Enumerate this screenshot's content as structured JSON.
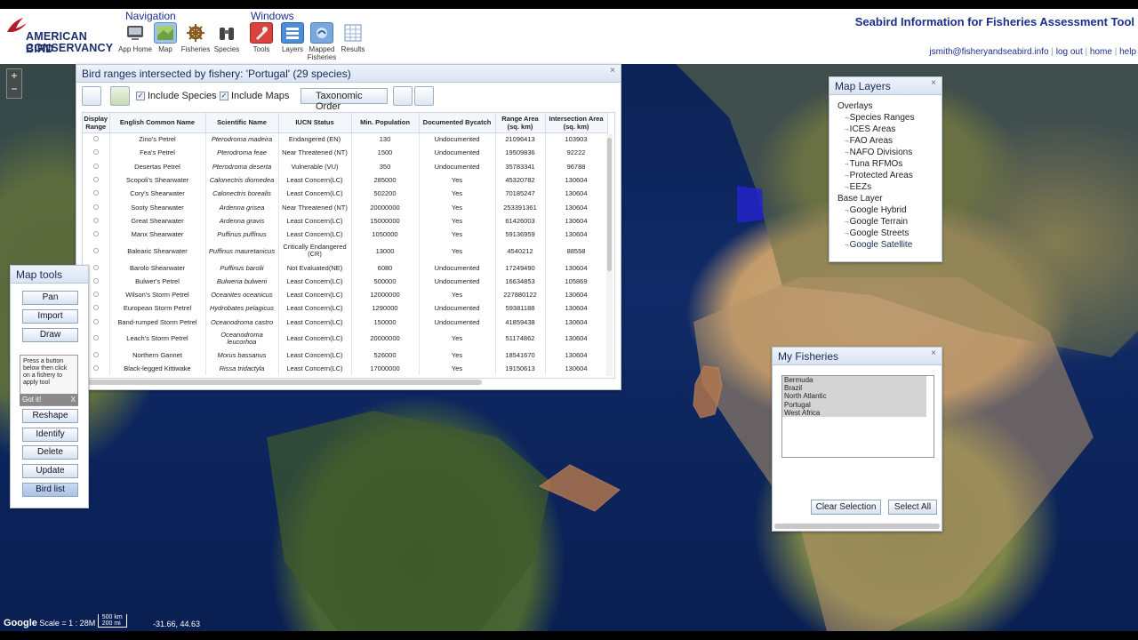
{
  "header": {
    "logo_line1": "AMERICAN BIRD",
    "logo_line2": "CONSERVANCY",
    "nav_heading": "Navigation",
    "windows_heading": "Windows",
    "nav": [
      {
        "label": "App Home",
        "icon": "app-home-icon"
      },
      {
        "label": "Map",
        "icon": "map-icon"
      },
      {
        "label": "Fisheries",
        "icon": "ship-wheel-icon"
      },
      {
        "label": "Species",
        "icon": "binoculars-icon"
      }
    ],
    "windows": [
      {
        "label": "Tools",
        "icon": "tools-icon"
      },
      {
        "label": "Layers",
        "icon": "layers-icon"
      },
      {
        "label": "Mapped Fisheries",
        "icon": "mapped-fisheries-icon"
      },
      {
        "label": "Results",
        "icon": "results-icon"
      }
    ],
    "app_title": "Seabird Information for Fisheries Assessment Tool",
    "user_email": "jsmith@fisheryandseabird.info",
    "links": [
      "log out",
      "home",
      "help"
    ]
  },
  "birds_panel": {
    "title": "Bird ranges intersected by fishery: 'Portugal' (29 species)",
    "include_species": "Include Species",
    "include_maps": "Include Maps",
    "taxonomic_order": "Taxonomic Order",
    "columns": [
      "Display Range",
      "English Common Name",
      "Scientific Name",
      "IUCN Status",
      "Min. Population",
      "Documented Bycatch",
      "Range Area (sq. km)",
      "Intersection Area (sq. km)"
    ],
    "rows": [
      [
        "Zino's Petrel",
        "Pterodroma madeira",
        "Endangered (EN)",
        "130",
        "Undocumented",
        "21096413",
        "103903"
      ],
      [
        "Fea's Petrel",
        "Pterodroma feae",
        "Near Threatened (NT)",
        "1500",
        "Undocumented",
        "19509836",
        "92222"
      ],
      [
        "Desertas Petrel",
        "Pterodroma deserta",
        "Vulnerable (VU)",
        "350",
        "Undocumented",
        "35783341",
        "96788"
      ],
      [
        "Scopoli's Shearwater",
        "Calonectris diomedea",
        "Least Concern(LC)",
        "285000",
        "Yes",
        "45320782",
        "130604"
      ],
      [
        "Cory's Shearwater",
        "Calonectris borealis",
        "Least Concern(LC)",
        "502200",
        "Yes",
        "70185247",
        "130604"
      ],
      [
        "Sooty Shearwater",
        "Ardenna grisea",
        "Near Threatened (NT)",
        "20000000",
        "Yes",
        "253391361",
        "130604"
      ],
      [
        "Great Shearwater",
        "Ardenna gravis",
        "Least Concern(LC)",
        "15000000",
        "Yes",
        "61426003",
        "130604"
      ],
      [
        "Manx Shearwater",
        "Puffinus puffinus",
        "Least Concern(LC)",
        "1050000",
        "Yes",
        "59136959",
        "130604"
      ],
      [
        "Balearic Shearwater",
        "Puffinus mauretanicus",
        "Critically Endangered (CR)",
        "13000",
        "Yes",
        "4540212",
        "88558"
      ],
      [
        "Barolo Shearwater",
        "Puffinus barolii",
        "Not Evaluated(NE)",
        "6080",
        "Undocumented",
        "17249490",
        "130604"
      ],
      [
        "Bulwer's Petrel",
        "Bulweria bulwerii",
        "Least Concern(LC)",
        "500000",
        "Undocumented",
        "16634853",
        "105869"
      ],
      [
        "Wilson's Storm Petrel",
        "Oceanites oceanicus",
        "Least Concern(LC)",
        "12000000",
        "Yes",
        "227880122",
        "130604"
      ],
      [
        "European Storm Petrel",
        "Hydrobates pelagicus",
        "Least Concern(LC)",
        "1290000",
        "Undocumented",
        "59381188",
        "130604"
      ],
      [
        "Band-rumped Storm Petrel",
        "Oceanodroma castro",
        "Least Concern(LC)",
        "150000",
        "Undocumented",
        "41859438",
        "130604"
      ],
      [
        "Leach's Storm Petrel",
        "Oceanodroma leucorhoa",
        "Least Concern(LC)",
        "20000000",
        "Yes",
        "51174862",
        "130604"
      ],
      [
        "Northern Gannet",
        "Morus bassanus",
        "Least Concern(LC)",
        "526000",
        "Yes",
        "18541670",
        "130604"
      ],
      [
        "Black-legged Kittiwake",
        "Rissa tridactyla",
        "Least Concern(LC)",
        "17000000",
        "Yes",
        "19150613",
        "130604"
      ]
    ]
  },
  "layers_panel": {
    "title": "Map Layers",
    "overlays_label": "Overlays",
    "overlays": [
      "Species Ranges",
      "ICES Areas",
      "FAO Areas",
      "NAFO Divisions",
      "Tuna RFMOs",
      "Protected Areas",
      "EEZs"
    ],
    "base_label": "Base Layer",
    "base": [
      "Google Hybrid",
      "Google Terrain",
      "Google Streets",
      "Google Satellite"
    ]
  },
  "tools_panel": {
    "title": "Map tools",
    "buttons": [
      "Pan",
      "Import",
      "Draw"
    ],
    "tip": "Press a button below then click on a fishery to apply tool",
    "got_it": "Got it!",
    "close_x": "X",
    "buttons2": [
      "Reshape",
      "Identify",
      "Delete",
      "Update",
      "Bird list"
    ]
  },
  "fisheries_panel": {
    "title": "My Fisheries",
    "items": [
      "Bermuda",
      "Brazil",
      "North Atlantic",
      "Portugal",
      "West Africa"
    ],
    "clear": "Clear Selection",
    "select_all": "Select All"
  },
  "map": {
    "scale": "Scale = 1 : 28M",
    "scale_km": "500 km",
    "scale_mi": "200 mi",
    "coords": "-31.66, 44.63",
    "google": "Google"
  },
  "colors": {
    "accent": "#1b2f8a",
    "fishery_fill": "#b7784c",
    "portugal_fill": "#2323c8"
  }
}
